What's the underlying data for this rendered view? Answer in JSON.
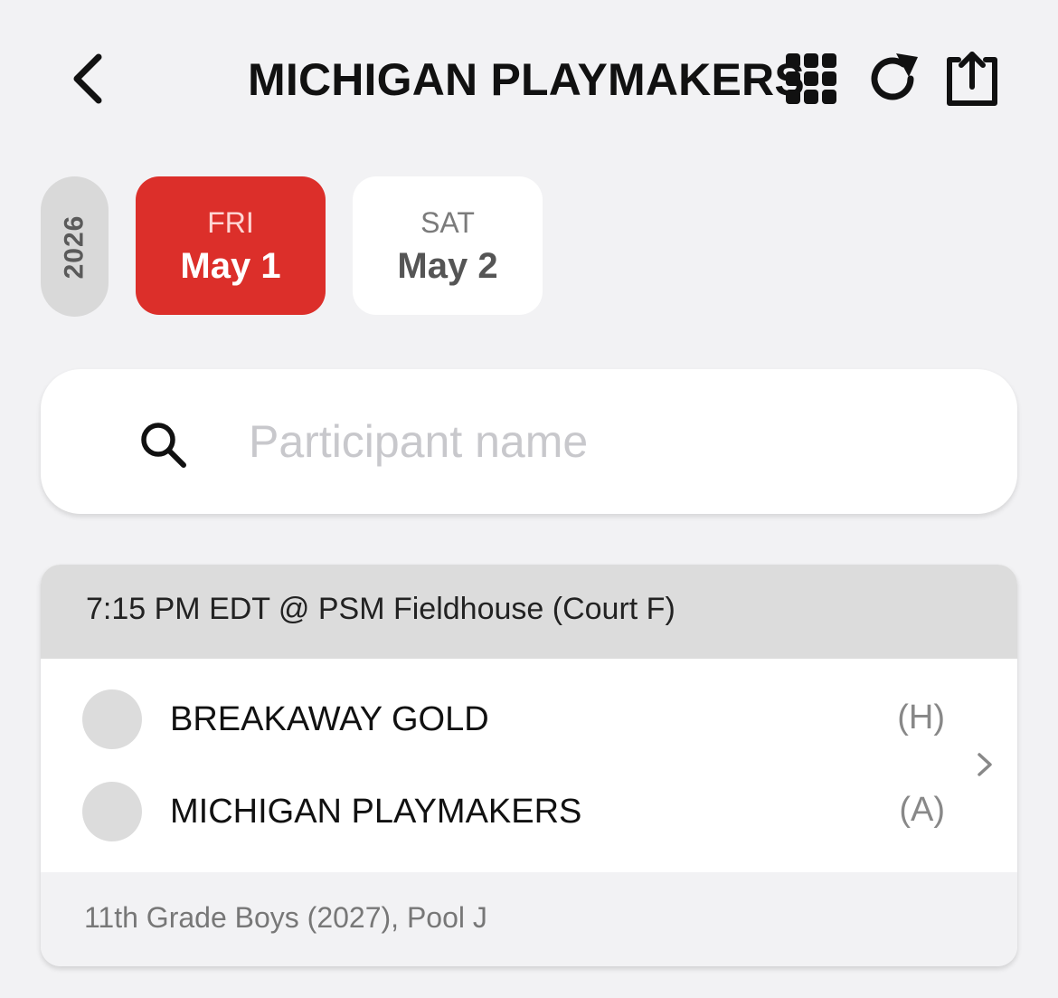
{
  "header": {
    "title": "MICHIGAN PLAYMAKERS",
    "icons": [
      "back-icon",
      "grid-icon",
      "refresh-icon",
      "share-icon"
    ]
  },
  "dates": {
    "year": "2026",
    "days": [
      {
        "dow": "FRI",
        "date": "May 1",
        "active": true
      },
      {
        "dow": "SAT",
        "date": "May 2",
        "active": false
      }
    ]
  },
  "search": {
    "placeholder": "Participant name",
    "value": ""
  },
  "game": {
    "header": "7:15 PM EDT @ PSM Fieldhouse (Court F)",
    "teams": [
      {
        "name": "BREAKAWAY GOLD",
        "side": "(H)"
      },
      {
        "name": "MICHIGAN PLAYMAKERS",
        "side": "(A)"
      }
    ],
    "footer": "11th Grade Boys (2027), Pool J"
  },
  "colors": {
    "accent": "#dc2f2a",
    "background": "#f2f2f4"
  }
}
